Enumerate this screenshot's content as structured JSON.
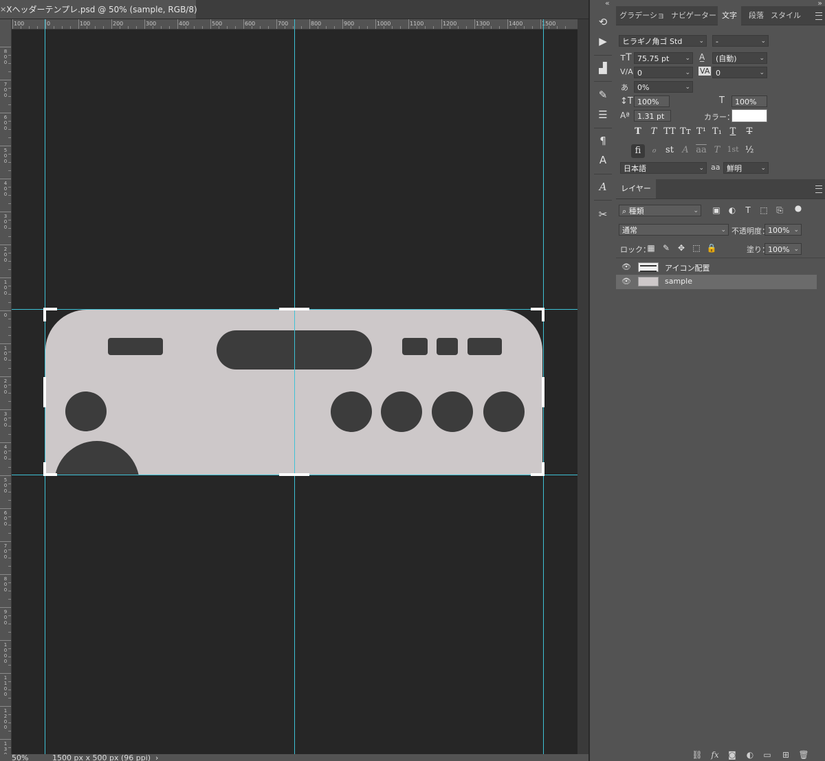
{
  "document": {
    "close_glyph": "×",
    "title": "Xヘッダーテンプレ.psd @ 50% (sample, RGB/8)",
    "zoom": "50%",
    "doc_info": "1500 px x 500 px (96 ppi)",
    "info_arrow": "›"
  },
  "ruler_top": [
    "100",
    "0",
    "100",
    "200",
    "300",
    "400",
    "500",
    "600",
    "700",
    "800",
    "900",
    "1000",
    "1100",
    "1200",
    "1300",
    "1400",
    "1500"
  ],
  "ruler_left": [
    "800",
    "700",
    "600",
    "500",
    "400",
    "300",
    "200",
    "100",
    "0",
    "100",
    "200",
    "300",
    "400",
    "500",
    "600",
    "700",
    "800",
    "900",
    "1000",
    "1100",
    "1200",
    "1300"
  ],
  "colors": {
    "artboard": "#cdc8c9",
    "shapes": "#3c3c3c",
    "guides": "#3ec2d6",
    "canvas_bg": "#262626",
    "panel_bg": "#535353"
  },
  "toolbar": {
    "collapse_glyph": "«",
    "icons": [
      "history-brush-icon",
      "play-action-icon",
      "histogram-icon",
      "brush-settings-icon",
      "adjustments-icon",
      "paragraph-icon",
      "character-icon",
      "glyphs-icon",
      "tool-presets-icon"
    ]
  },
  "character_panel": {
    "collapse_glyph": "»",
    "tabs": [
      "グラデーショ",
      "ナビゲーター",
      "文字",
      "段落",
      "スタイル"
    ],
    "font_family": "ヒラギノ角ゴ Std",
    "font_style": "-",
    "font_size": "75.75 pt",
    "leading": "(自動)",
    "kerning": "0",
    "tracking": "0",
    "tsume": "0%",
    "vertical_scale": "100%",
    "horizontal_scale": "100%",
    "baseline_shift": "1.31 pt",
    "color_label": "カラー：",
    "color_value": "#ffffff",
    "language": "日本語",
    "antialias_icon": "aa",
    "antialias": "鮮明",
    "style_buttons": [
      "T",
      "T",
      "TT",
      "Tт",
      "T¹",
      "T₁",
      "T",
      "T"
    ],
    "opentype_buttons": [
      "fi",
      "ℴ",
      "st",
      "A",
      "aa",
      "T",
      "1st",
      "½"
    ]
  },
  "layers_panel": {
    "tab": "レイヤー",
    "filter_label": "種類",
    "blend_mode": "通常",
    "opacity_label": "不透明度：",
    "opacity": "100%",
    "lock_label": "ロック：",
    "fill_label": "塗り：",
    "fill": "100%",
    "layers": [
      {
        "name": "アイコン配置",
        "visible": true,
        "selected": false
      },
      {
        "name": "sample",
        "visible": true,
        "selected": true
      }
    ],
    "footer_icons": [
      "link-layers-icon",
      "fx-icon",
      "add-mask-icon",
      "adjustment-layer-icon",
      "new-group-icon",
      "new-layer-icon",
      "trash-icon"
    ]
  }
}
